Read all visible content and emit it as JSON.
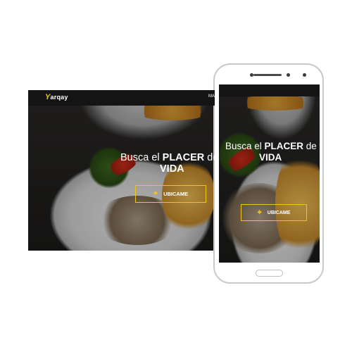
{
  "brand": {
    "logo_mark": "Y",
    "logo_text": "arqay"
  },
  "desktop": {
    "nav_link": "MA",
    "hero_prefix": "Busca el ",
    "hero_highlight": "PLACER",
    "hero_suffix": " de tu",
    "hero_line2": "VIDA",
    "cta_label": "UBICAME",
    "cta_icon": "crosshair-target-icon"
  },
  "mobile": {
    "hero_prefix": "Busca el ",
    "hero_highlight": "PLACER",
    "hero_suffix": " de tu",
    "hero_line2": "VIDA",
    "cta_label": "UBICAME",
    "cta_icon": "crosshair-target-icon"
  },
  "colors": {
    "accent": "#f0c419",
    "navbar": "#141414",
    "text": "#ffffff"
  }
}
